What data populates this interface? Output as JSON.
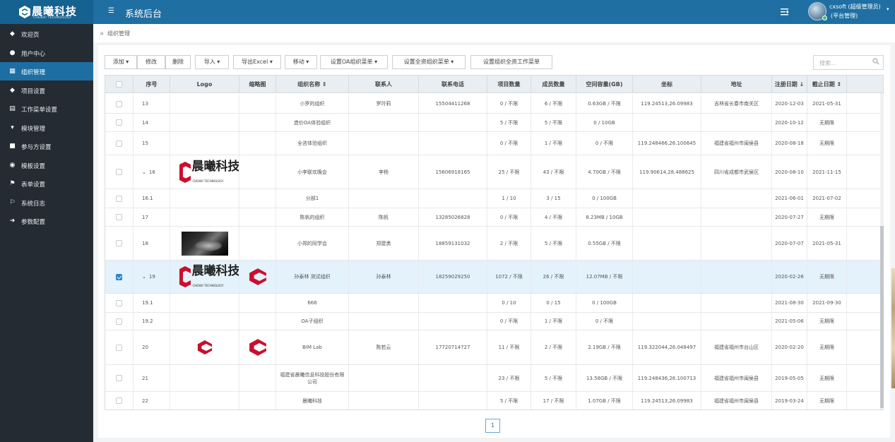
{
  "app": {
    "logo_text": "晨曦科技",
    "logo_sub": "CHENXI TECHNOLOGY",
    "system_title": "系统后台",
    "user_name": "cxsoft (超级管理员)",
    "user_role": "(平台管理)"
  },
  "sidebar": {
    "items": [
      {
        "label": "欢迎页",
        "icon": "tag-icon"
      },
      {
        "label": "用户中心",
        "icon": "user-icon"
      },
      {
        "label": "组织管理",
        "icon": "grid-icon",
        "active": true
      },
      {
        "label": "项目设置",
        "icon": "tag-icon"
      },
      {
        "label": "工作菜单设置",
        "icon": "list-icon"
      },
      {
        "label": "模块管理",
        "icon": "cart-icon"
      },
      {
        "label": "参与方设置",
        "icon": "video-icon"
      },
      {
        "label": "模板设置",
        "icon": "dashboard-icon"
      },
      {
        "label": "表单设置",
        "icon": "flag-icon"
      },
      {
        "label": "系统日志",
        "icon": "flag-outline-icon"
      },
      {
        "label": "参数配置",
        "icon": "key-icon"
      }
    ]
  },
  "breadcrumb": {
    "label": "组织管理"
  },
  "toolbar": {
    "add": "添加",
    "edit": "修改",
    "delete": "删除",
    "import": "导入",
    "export_excel": "导出Excel",
    "move": "移动",
    "set_oa_menu": "设置OA组织菜单",
    "set_full_menu": "设置全资组织菜单",
    "set_full_work_menu": "设置组织全资工作菜单"
  },
  "search": {
    "placeholder": "搜索..."
  },
  "table": {
    "headers": [
      "",
      "序号",
      "Logo",
      "缩略图",
      "组织名称 ⇕",
      "联系人",
      "联系电话",
      "项目数量",
      "成员数量",
      "空间容量(GB)",
      "坐标",
      "地址",
      "注册日期 ↓",
      "截止日期 ⇕"
    ],
    "rows": [
      {
        "no": "13",
        "logo": "",
        "thumb": "",
        "name": "小罗的组织",
        "contact": "罗玲莉",
        "phone": "15504411268",
        "projects": "0 / 不限",
        "members": "6 / 不限",
        "space": "0.63GB / 不限",
        "coord": "119.24513,26.09983",
        "address": "吉林省长春市南关区",
        "reg": "2020-12-03",
        "end": "2021-05-31"
      },
      {
        "no": "14",
        "logo": "",
        "thumb": "",
        "name": "造价OA体验组织",
        "contact": "",
        "phone": "",
        "projects": "5 / 不限",
        "members": "5 / 不限",
        "space": "0 / 10GB",
        "coord": "",
        "address": "",
        "reg": "2020-10-12",
        "end": "无期限"
      },
      {
        "no": "15",
        "logo": "",
        "thumb": "",
        "name": "全咨体验组织",
        "contact": "",
        "phone": "",
        "projects": "0 / 不限",
        "members": "1 / 不限",
        "space": "0 / 不限",
        "coord": "119.248466,26.100645",
        "address": "福建省福州市闽侯县",
        "reg": "2020-08-18",
        "end": "无期限"
      },
      {
        "no": "16",
        "expand": true,
        "logo": "cx",
        "thumb": "",
        "name": "小李联欢晚会",
        "contact": "李杨",
        "phone": "15606918165",
        "projects": "25 / 不限",
        "members": "43 / 不限",
        "space": "4.70GB / 不限",
        "coord": "119.90614,28.488625",
        "address": "四川省成都市武侯区",
        "reg": "2020-08-10",
        "end": "2021-11-15"
      },
      {
        "no": "16.1",
        "logo": "",
        "thumb": "",
        "name": "分部1",
        "contact": "",
        "phone": "",
        "projects": "1 / 10",
        "members": "3 / 15",
        "space": "0 / 100GB",
        "coord": "",
        "address": "",
        "reg": "2021-06-01",
        "end": "2021-07-02"
      },
      {
        "no": "17",
        "logo": "",
        "thumb": "",
        "name": "陈帆的组织",
        "contact": "陈帆",
        "phone": "13285026828",
        "projects": "0 / 不限",
        "members": "4 / 不限",
        "space": "8.23MB / 10GB",
        "coord": "",
        "address": "",
        "reg": "2020-07-27",
        "end": "无期限"
      },
      {
        "no": "18",
        "logo": "photo",
        "thumb": "",
        "name": "小郑的同学会",
        "contact": "郑建勇",
        "phone": "18859131032",
        "projects": "2 / 不限",
        "members": "5 / 不限",
        "space": "0.55GB / 不限",
        "coord": "",
        "address": "",
        "reg": "2020-07-07",
        "end": "2021-05-31"
      },
      {
        "no": "19",
        "expand": true,
        "selected": true,
        "logo": "cx",
        "thumb": "mark",
        "name": "孙泰林 测试组织",
        "contact": "孙泰林",
        "phone": "18259029250",
        "projects": "1072 / 不限",
        "members": "26 / 不限",
        "space": "12.07MB / 不限",
        "coord": "",
        "address": "",
        "reg": "2020-02-26",
        "end": "无期限"
      },
      {
        "no": "19.1",
        "logo": "",
        "thumb": "",
        "name": "666",
        "contact": "",
        "phone": "",
        "projects": "0 / 10",
        "members": "0 / 15",
        "space": "0 / 100GB",
        "coord": "",
        "address": "",
        "reg": "2021-08-30",
        "end": "2021-09-30"
      },
      {
        "no": "19.2",
        "logo": "",
        "thumb": "",
        "name": "OA子组织",
        "contact": "",
        "phone": "",
        "projects": "0 / 不限",
        "members": "1 / 不限",
        "space": "0 / 不限",
        "coord": "",
        "address": "",
        "reg": "2021-05-06",
        "end": "无期限"
      },
      {
        "no": "20",
        "logo": "mark",
        "thumb": "mark",
        "name": "BIM Lab",
        "contact": "陈若云",
        "phone": "17720714727",
        "projects": "11 / 不限",
        "members": "2 / 不限",
        "space": "2.19GB / 不限",
        "coord": "119.322044,26.048497",
        "address": "福建省福州市台山区",
        "reg": "2020-02-20",
        "end": "无期限"
      },
      {
        "no": "21",
        "logo": "",
        "thumb": "",
        "name": "福建省晨曦信息科技股份有限公司",
        "contact": "",
        "phone": "",
        "projects": "23 / 不限",
        "members": "5 / 不限",
        "space": "13.58GB / 不限",
        "coord": "119.248436,26.100713",
        "address": "福建省福州市闽侯县",
        "reg": "2019-05-05",
        "end": "无期限"
      },
      {
        "no": "22",
        "logo": "",
        "thumb": "",
        "name": "晨曦科技",
        "contact": "",
        "phone": "",
        "projects": "5 / 不限",
        "members": "17 / 不限",
        "space": "1.07GB / 不限",
        "coord": "119.24513,26.09983",
        "address": "福建省福州市闽侯县",
        "reg": "2019-03-24",
        "end": "无期限"
      }
    ]
  },
  "pager": {
    "current": "1"
  },
  "colors": {
    "topbar": "#1f6fa2",
    "sidebar": "#242b33",
    "active": "#1d6fa3",
    "brand_red": "#c8102e"
  }
}
